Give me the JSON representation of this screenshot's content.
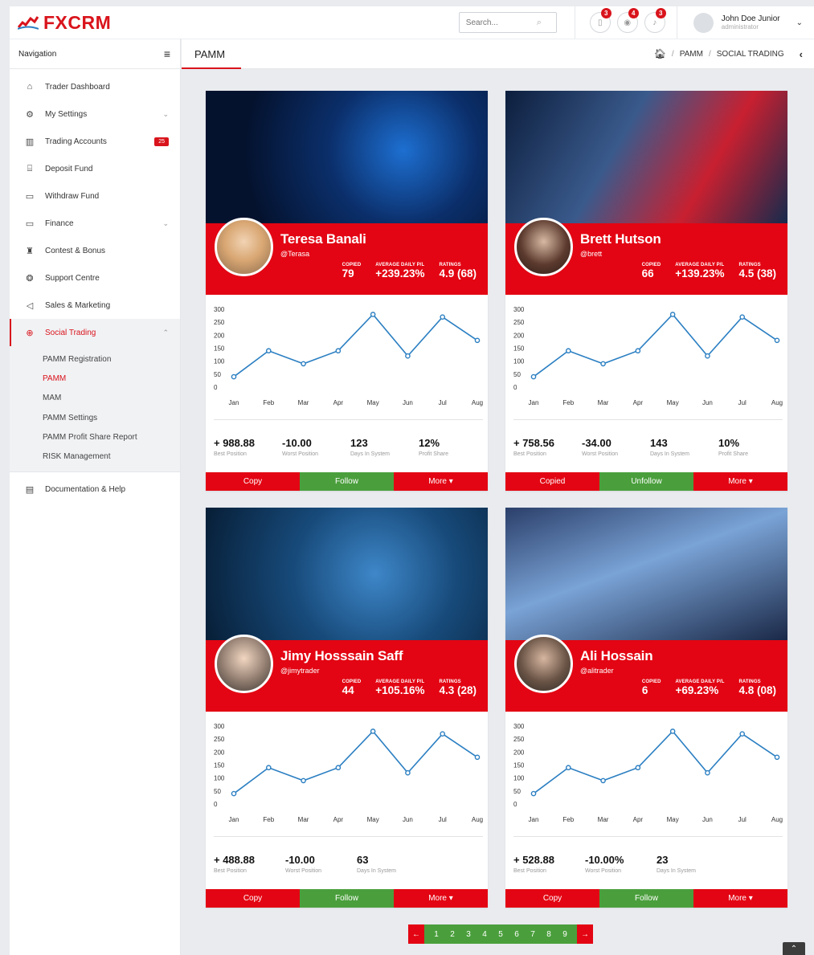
{
  "brand": {
    "name": "FXCRM",
    "accent": "#d9141c",
    "green": "#4a9f3c"
  },
  "topbar": {
    "search_placeholder": "Search...",
    "notifications": [
      {
        "icon": "document-icon",
        "count": "3"
      },
      {
        "icon": "eye-icon",
        "count": "4"
      },
      {
        "icon": "bell-icon",
        "count": "3"
      }
    ],
    "user": {
      "name": "John Doe Junior",
      "role": "administrator"
    }
  },
  "sidebar": {
    "title": "Navigation",
    "items": [
      {
        "label": "Trader Dashboard",
        "icon": "home-icon"
      },
      {
        "label": "My Settings",
        "icon": "gear-icon",
        "expandable": true
      },
      {
        "label": "Trading Accounts",
        "icon": "chart-bars-icon",
        "count": "25"
      },
      {
        "label": "Deposit Fund",
        "icon": "bank-icon"
      },
      {
        "label": "Withdraw Fund",
        "icon": "wallet-icon"
      },
      {
        "label": "Finance",
        "icon": "folder-icon",
        "expandable": true
      },
      {
        "label": "Contest & Bonus",
        "icon": "trophy-icon"
      },
      {
        "label": "Support Centre",
        "icon": "lifebuoy-icon"
      },
      {
        "label": "Sales & Marketing",
        "icon": "megaphone-icon"
      },
      {
        "label": "Social Trading",
        "icon": "globe-icon",
        "expandable": true,
        "active": true
      }
    ],
    "sub_items": [
      {
        "label": "PAMM Registration"
      },
      {
        "label": "PAMM",
        "active": true
      },
      {
        "label": "MAM"
      },
      {
        "label": "PAMM Settings"
      },
      {
        "label": "PAMM Profit Share Report"
      },
      {
        "label": "RISK Management"
      }
    ],
    "footer_item": {
      "label": "Documentation & Help",
      "icon": "book-icon"
    }
  },
  "header": {
    "page_title": "PAMM",
    "breadcrumb": [
      "PAMM",
      "SOCIAL TRADING"
    ]
  },
  "stat_labels": {
    "copied": "COPIED",
    "avg": "AVERAGE DAILY P/L",
    "ratings": "RATINGS"
  },
  "chart_data": {
    "type": "line",
    "categories": [
      "Jan",
      "Feb",
      "Mar",
      "Apr",
      "May",
      "Jun",
      "Jul",
      "Aug"
    ],
    "values": [
      40,
      140,
      90,
      140,
      280,
      120,
      270,
      180
    ],
    "ylim": [
      0,
      300
    ],
    "yticks": [
      "300",
      "250",
      "200",
      "150",
      "100",
      "50",
      "0"
    ],
    "color": "#2b7fc2"
  },
  "traders": [
    {
      "name": "Teresa Banali",
      "handle": "@Terasa",
      "copied": "79",
      "avg": "+239.23%",
      "ratings": "4.9 (68)",
      "metrics": [
        {
          "value": "+ 988.88",
          "label": "Best Position"
        },
        {
          "value": "-10.00",
          "label": "Worst Position"
        },
        {
          "value": "123",
          "label": "Days In System"
        },
        {
          "value": "12%",
          "label": "Profit Share"
        }
      ],
      "actions": [
        "Copy",
        "Follow",
        "More ▾"
      ]
    },
    {
      "name": "Brett Hutson",
      "handle": "@brett",
      "copied": "66",
      "avg": "+139.23%",
      "ratings": "4.5 (38)",
      "metrics": [
        {
          "value": "+ 758.56",
          "label": "Best Position"
        },
        {
          "value": "-34.00",
          "label": "Worst Position"
        },
        {
          "value": "143",
          "label": "Days In System"
        },
        {
          "value": "10%",
          "label": "Profit Share"
        }
      ],
      "actions": [
        "Copied",
        "Unfollow",
        "More ▾"
      ]
    },
    {
      "name": "Jimy Hosssain Saff",
      "handle": "@jimytrader",
      "copied": "44",
      "avg": "+105.16%",
      "ratings": "4.3 (28)",
      "metrics": [
        {
          "value": "+ 488.88",
          "label": "Best Position"
        },
        {
          "value": "-10.00",
          "label": "Worst Position"
        },
        {
          "value": "63",
          "label": "Days In System"
        }
      ],
      "actions": [
        "Copy",
        "Follow",
        "More ▾"
      ]
    },
    {
      "name": "Ali Hossain",
      "handle": "@alitrader",
      "copied": "6",
      "avg": "+69.23%",
      "ratings": "4.8 (08)",
      "metrics": [
        {
          "value": "+ 528.88",
          "label": "Best Position"
        },
        {
          "value": "-10.00%",
          "label": "Worst Position"
        },
        {
          "value": "23",
          "label": "Days In System"
        }
      ],
      "actions": [
        "Copy",
        "Follow",
        "More ▾"
      ]
    }
  ],
  "pagination": {
    "pages": [
      "1",
      "2",
      "3",
      "4",
      "5",
      "6",
      "7",
      "8",
      "9"
    ]
  }
}
